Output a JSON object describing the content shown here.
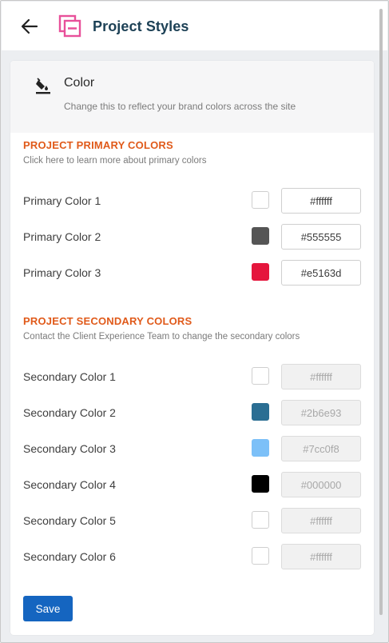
{
  "header": {
    "title": "Project Styles",
    "back_icon": "arrow-left-icon",
    "logo_icon": "project-styles-logo-icon",
    "logo_color": "#e8509a"
  },
  "color_panel": {
    "icon": "paint-bucket-icon",
    "title": "Color",
    "subtitle": "Change this to reflect your brand colors across the site"
  },
  "primary": {
    "title": "PROJECT PRIMARY COLORS",
    "subtitle": "Click here to learn more about primary colors",
    "colors": [
      {
        "label": "Primary Color 1",
        "value": "#ffffff"
      },
      {
        "label": "Primary Color 2",
        "value": "#555555"
      },
      {
        "label": "Primary Color 3",
        "value": "#e5163d"
      }
    ]
  },
  "secondary": {
    "title": "PROJECT SECONDARY COLORS",
    "subtitle": "Contact the Client Experience Team to change the secondary colors",
    "colors": [
      {
        "label": "Secondary Color 1",
        "value": "#ffffff"
      },
      {
        "label": "Secondary Color 2",
        "value": "#2b6e93"
      },
      {
        "label": "Secondary Color 3",
        "value": "#7cc0f8"
      },
      {
        "label": "Secondary Color 4",
        "value": "#000000"
      },
      {
        "label": "Secondary Color 5",
        "value": "#ffffff"
      },
      {
        "label": "Secondary Color 6",
        "value": "#ffffff"
      }
    ]
  },
  "actions": {
    "save_label": "Save",
    "save_color": "#1565c0"
  },
  "theme": {
    "section_title_color": "#e05a1a",
    "header_title_color": "#1d4156"
  }
}
